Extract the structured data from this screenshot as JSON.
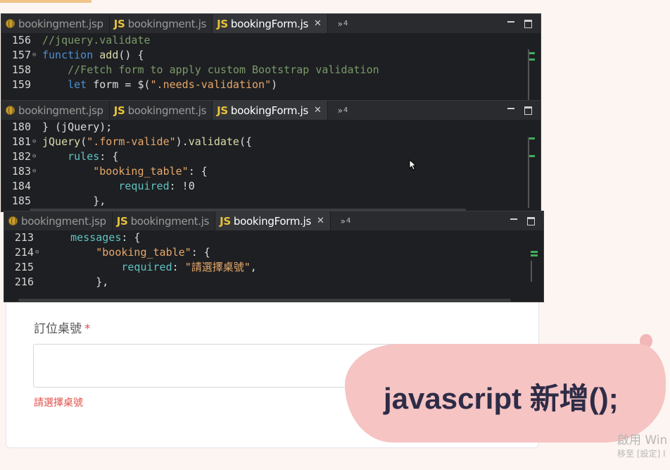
{
  "editor_tabs": [
    {
      "icon": "globe-icon",
      "label": "bookingment.jsp",
      "active": false
    },
    {
      "icon": "js-icon",
      "prefix": "JS",
      "label": "bookingment.js",
      "active": false
    },
    {
      "icon": "js-icon",
      "prefix": "JS",
      "label": "bookingForm.js",
      "active": true
    }
  ],
  "overflow_label": "»",
  "overflow_count": "4",
  "panel1": {
    "lines": [
      {
        "num": "156",
        "fold": false,
        "code": "//jquery.validate"
      },
      {
        "num": "157",
        "fold": true,
        "code": "function add() {"
      },
      {
        "num": "158",
        "fold": false,
        "code": "    //Fetch form to apply custom Bootstrap validation"
      },
      {
        "num": "159",
        "fold": false,
        "code": "    let form = $(\".needs-validation\")"
      }
    ]
  },
  "panel2": {
    "lines": [
      {
        "num": "180",
        "fold": false,
        "code": "} (jQuery);"
      },
      {
        "num": "181",
        "fold": true,
        "code": "jQuery(\".form-valide\").validate({"
      },
      {
        "num": "182",
        "fold": true,
        "code": "    rules: {"
      },
      {
        "num": "183",
        "fold": true,
        "code": "        \"booking_table\": {"
      },
      {
        "num": "184",
        "fold": false,
        "code": "            required: !0"
      },
      {
        "num": "185",
        "fold": false,
        "code": "        },"
      }
    ]
  },
  "panel3": {
    "lines": [
      {
        "num": "213",
        "fold": false,
        "code": "    messages: {"
      },
      {
        "num": "214",
        "fold": true,
        "code": "        \"booking_table\": {"
      },
      {
        "num": "215",
        "fold": false,
        "code": "            required: \"請選擇桌號\","
      },
      {
        "num": "216",
        "fold": false,
        "code": "        },"
      }
    ]
  },
  "form": {
    "label": "訂位桌號",
    "required_mark": "*",
    "input_value": "",
    "error_text": "請選擇桌號"
  },
  "caption": "javascript 新增();",
  "watermark": {
    "line1": "啟用 Win",
    "line2": "移至 [設定] I"
  },
  "colors": {
    "editor_bg": "#1e1f22",
    "tab_bar": "#2a2b2e",
    "comment": "#7a9a6a",
    "keyword": "#4d8fd6",
    "string": "#e6a86a",
    "error": "#e0504a",
    "bubble": "#f5c4c3"
  }
}
